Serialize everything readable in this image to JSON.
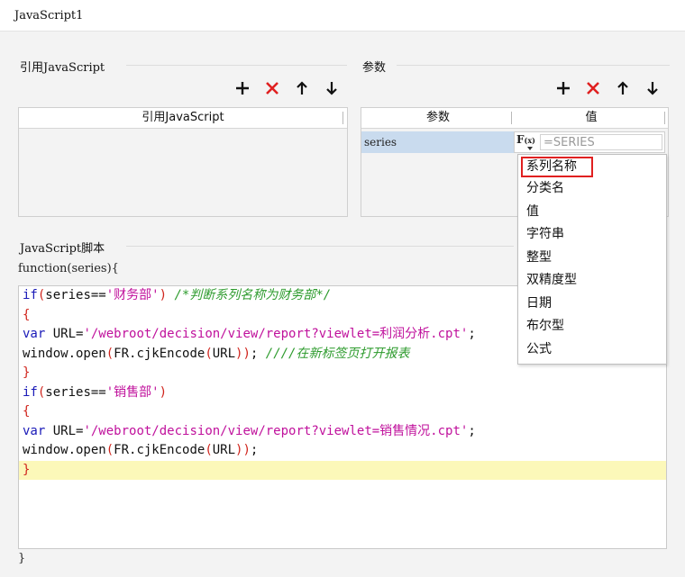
{
  "tab": {
    "title": "JavaScript1"
  },
  "left_panel": {
    "section_title": "引用JavaScript",
    "column_header": "引用JavaScript"
  },
  "right_panel": {
    "section_title": "参数",
    "columns": [
      "参数",
      "值"
    ],
    "row": {
      "name": "series",
      "value_placeholder": "=SERIES",
      "fx_label": "F",
      "fx_sub": "(x)"
    }
  },
  "toolbar": {
    "icons": [
      "add-icon",
      "delete-icon",
      "arrow-up-icon",
      "arrow-down-icon"
    ]
  },
  "dropdown": {
    "items": [
      "系列名称",
      "分类名",
      "值",
      "字符串",
      "整型",
      "双精度型",
      "日期",
      "布尔型",
      "公式"
    ],
    "highlighted_index": 0
  },
  "script": {
    "section_title": "JavaScript脚本",
    "signature": "function(series){",
    "closing": "}",
    "lines": [
      [
        {
          "t": "kw",
          "v": "if"
        },
        {
          "t": "br",
          "v": "("
        },
        {
          "t": "plain",
          "v": "series=="
        },
        {
          "t": "str",
          "v": "'财务部'"
        },
        {
          "t": "br",
          "v": ")"
        },
        {
          "t": "plain",
          "v": " "
        },
        {
          "t": "cm",
          "v": "/*判断系列名称为财务部*/"
        }
      ],
      [
        {
          "t": "br",
          "v": "{"
        }
      ],
      [
        {
          "t": "kw",
          "v": "var"
        },
        {
          "t": "plain",
          "v": " URL="
        },
        {
          "t": "str",
          "v": "'/webroot/decision/view/report?viewlet=利润分析.cpt'"
        },
        {
          "t": "plain",
          "v": ";"
        }
      ],
      [
        {
          "t": "plain",
          "v": "window.open"
        },
        {
          "t": "br",
          "v": "("
        },
        {
          "t": "plain",
          "v": "FR.cjkEncode"
        },
        {
          "t": "br",
          "v": "("
        },
        {
          "t": "plain",
          "v": "URL"
        },
        {
          "t": "br",
          "v": "))"
        },
        {
          "t": "plain",
          "v": "; "
        },
        {
          "t": "cm",
          "v": "////在新标签页打开报表"
        }
      ],
      [
        {
          "t": "br",
          "v": "}"
        }
      ],
      [
        {
          "t": "kw",
          "v": "if"
        },
        {
          "t": "br",
          "v": "("
        },
        {
          "t": "plain",
          "v": "series=="
        },
        {
          "t": "str",
          "v": "'销售部'"
        },
        {
          "t": "br",
          "v": ")"
        }
      ],
      [
        {
          "t": "br",
          "v": "{"
        }
      ],
      [
        {
          "t": "kw",
          "v": "var"
        },
        {
          "t": "plain",
          "v": " URL="
        },
        {
          "t": "str",
          "v": "'/webroot/decision/view/report?viewlet=销售情况.cpt'"
        },
        {
          "t": "plain",
          "v": ";"
        }
      ],
      [
        {
          "t": "plain",
          "v": "window.open"
        },
        {
          "t": "br",
          "v": "("
        },
        {
          "t": "plain",
          "v": "FR.cjkEncode"
        },
        {
          "t": "br",
          "v": "("
        },
        {
          "t": "plain",
          "v": "URL"
        },
        {
          "t": "br",
          "v": "))"
        },
        {
          "t": "plain",
          "v": ";"
        }
      ],
      [
        {
          "t": "br",
          "v": "}"
        }
      ]
    ],
    "active_line": 9
  },
  "colors": {
    "keyword": "#1a1ab8",
    "string": "#c0119c",
    "comment": "#2d9b2d",
    "brace": "#d0241c",
    "active_line": "#fcf8b9",
    "selected_row": "#c9dbee",
    "delete": "#e02020"
  }
}
